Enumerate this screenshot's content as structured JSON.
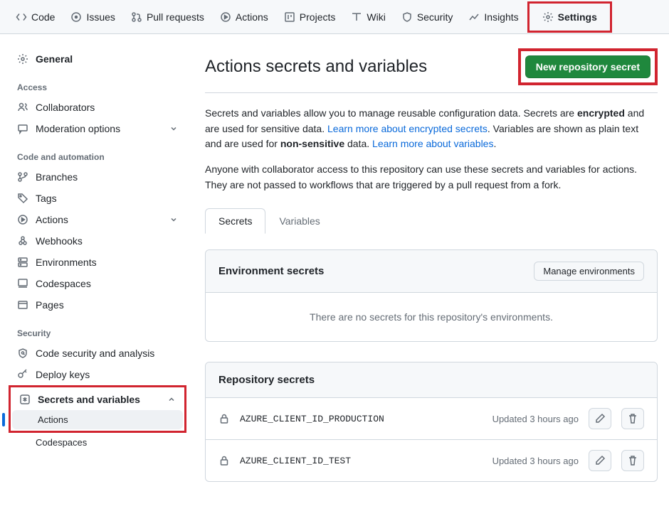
{
  "topnav": {
    "items": [
      {
        "name": "code",
        "label": "Code"
      },
      {
        "name": "issues",
        "label": "Issues"
      },
      {
        "name": "pulls",
        "label": "Pull requests"
      },
      {
        "name": "actions",
        "label": "Actions"
      },
      {
        "name": "projects",
        "label": "Projects"
      },
      {
        "name": "wiki",
        "label": "Wiki"
      },
      {
        "name": "security",
        "label": "Security"
      },
      {
        "name": "insights",
        "label": "Insights"
      },
      {
        "name": "settings",
        "label": "Settings"
      }
    ]
  },
  "sidebar": {
    "general": "General",
    "groups": {
      "access": {
        "title": "Access",
        "items": [
          {
            "label": "Collaborators"
          },
          {
            "label": "Moderation options",
            "expandable": true
          }
        ]
      },
      "code": {
        "title": "Code and automation",
        "items": [
          {
            "label": "Branches"
          },
          {
            "label": "Tags"
          },
          {
            "label": "Actions",
            "expandable": true
          },
          {
            "label": "Webhooks"
          },
          {
            "label": "Environments"
          },
          {
            "label": "Codespaces"
          },
          {
            "label": "Pages"
          }
        ]
      },
      "security": {
        "title": "Security",
        "items": [
          {
            "label": "Code security and analysis"
          },
          {
            "label": "Deploy keys"
          },
          {
            "label": "Secrets and variables",
            "expandable": true,
            "expanded": true
          }
        ],
        "subitems": [
          {
            "label": "Actions",
            "active": true
          },
          {
            "label": "Codespaces"
          }
        ]
      }
    }
  },
  "page": {
    "title": "Actions secrets and variables",
    "new_secret_btn": "New repository secret",
    "intro1_a": "Secrets and variables allow you to manage reusable configuration data. Secrets are ",
    "intro1_strong": "encrypted",
    "intro1_b": " and are used for sensitive data. ",
    "intro1_link": "Learn more about encrypted secrets",
    "intro1_c": ". Variables are shown as plain text and are used for ",
    "intro1_strong2": "non-sensitive",
    "intro1_d": " data. ",
    "intro1_link2": "Learn more about variables",
    "intro1_e": ".",
    "intro2": "Anyone with collaborator access to this repository can use these secrets and variables for actions. They are not passed to workflows that are triggered by a pull request from a fork.",
    "tabs": {
      "secrets": "Secrets",
      "variables": "Variables"
    },
    "env_secrets": {
      "title": "Environment secrets",
      "manage_btn": "Manage environments",
      "empty": "There are no secrets for this repository's environments."
    },
    "repo_secrets": {
      "title": "Repository secrets",
      "rows": [
        {
          "name": "AZURE_CLIENT_ID_PRODUCTION",
          "updated": "Updated 3 hours ago"
        },
        {
          "name": "AZURE_CLIENT_ID_TEST",
          "updated": "Updated 3 hours ago"
        }
      ]
    }
  }
}
